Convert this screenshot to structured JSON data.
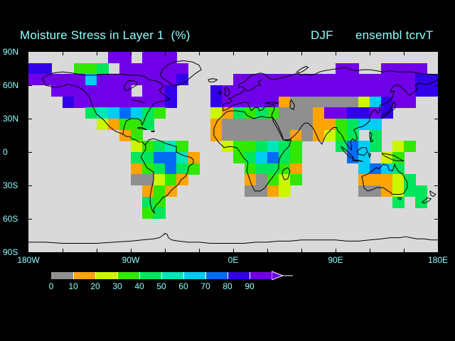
{
  "chart_data": {
    "type": "heatmap",
    "title": "Moisture Stress in Layer 1  (%)",
    "season": "DJF",
    "dataset": "ensembl tcrvT",
    "units": "%",
    "projection": "equirectangular world map, lon -180..180 deg, lat -90..90 deg",
    "background_color": "#000000",
    "label_color": "#8CFFFF",
    "no_data_color": "#D9D9D9",
    "x_axis": {
      "tick_step_deg": 30,
      "labels": [
        {
          "text": "180W",
          "lon": -180
        },
        {
          "text": "90W",
          "lon": -90
        },
        {
          "text": "0E",
          "lon": 0
        },
        {
          "text": "90E",
          "lon": 90
        },
        {
          "text": "180E",
          "lon": 180
        }
      ]
    },
    "y_axis": {
      "tick_step_deg": 30,
      "labels": [
        {
          "text": "90N",
          "lat": 90
        },
        {
          "text": "60N",
          "lat": 60
        },
        {
          "text": "30N",
          "lat": 30
        },
        {
          "text": "0",
          "lat": 0
        },
        {
          "text": "30S",
          "lat": -30
        },
        {
          "text": "60S",
          "lat": -60
        },
        {
          "text": "90S",
          "lat": -90
        }
      ]
    },
    "colorbar": {
      "tick_labels": [
        "0",
        "10",
        "20",
        "30",
        "40",
        "50",
        "60",
        "70",
        "80",
        "90"
      ],
      "segment_colors": [
        "#8F8F8F",
        "#FFA400",
        "#CCF500",
        "#30E800",
        "#00E65C",
        "#00E6B8",
        "#00CCF5",
        "#006CF5",
        "#3200E8",
        "#7000E8"
      ],
      "separator_color": "#FFFFFF",
      "arrow_note": "violet right-pointing arrow = values above 90"
    },
    "grid": {
      "description": "Approximate digitization of the filled contour field on a 10-degree grid. 18 rows from 90N down to 90S, 36 columns from 180W to 180E. Letter = moisture stress band, '.' = no data (map background).",
      "codes": {
        "G": "0-10",
        "O": "10-20",
        "Y": "20-30",
        "g": "30-40",
        "e": "40-50",
        "s": "50-60",
        "c": "60-70",
        "b": "70-80",
        "B": "80-90",
        "V": "90+"
      },
      "colors": {
        "G": "#8F8F8F",
        "O": "#FFA400",
        "Y": "#CCF500",
        "g": "#30E800",
        "e": "#00E65C",
        "s": "#00E6B8",
        "c": "#00CCF5",
        "b": "#006CF5",
        "B": "#3200E8",
        "V": "#7000E8"
      },
      "rows": [
        ".......VV.VVV.......................",
        "BB..gge.VVVVVV.............VV..VVVV.",
        "VVVVVcVVVVVVVB....VVVVVVVVVVVVVVVVBB",
        "..VVVVVVV.VVB...BVVVVVVVVVVVVVVVVVBB",
        "...BVVVVVVVVB...BVVVVVOGGGGGGYcBVV..",
        ".....escbceg....YOegegGGGOVVBBVB....",
        "......YOgge.....OGGGGGGGGOOgecc.....",
        "........Og......OGGGGGGOGOYge.e.....",
        ".........Ygesg...Yggeseg...ebce.Yg..",
        ".........eebbsO...gecbeg....bc.Yg...",
        ".........Ogebeg....geegO.....cbce...",
        ".........GGYgO.....OGgYg.....OOOYe..",
        "..........OgO......GGOY......GGOYee.",
        "..........eg....................e.e.",
        "..........ge........................",
        "....................................",
        "....................................",
        "...................................."
      ]
    }
  }
}
